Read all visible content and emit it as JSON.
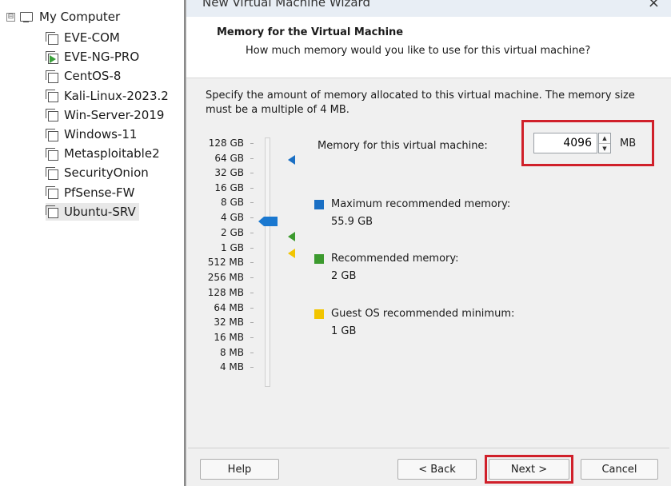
{
  "tree": {
    "root_label": "My Computer",
    "root_expander": "⊟",
    "vms": [
      {
        "label": "EVE-COM",
        "running": false
      },
      {
        "label": "EVE-NG-PRO",
        "running": true
      },
      {
        "label": "CentOS-8",
        "running": false
      },
      {
        "label": "Kali-Linux-2023.2",
        "running": false
      },
      {
        "label": "Win-Server-2019",
        "running": false
      },
      {
        "label": "Windows-11",
        "running": false
      },
      {
        "label": "Metasploitable2",
        "running": false
      },
      {
        "label": "SecurityOnion",
        "running": false
      },
      {
        "label": "PfSense-FW",
        "running": false
      },
      {
        "label": "Ubuntu-SRV",
        "running": false
      }
    ],
    "selected_vm": "Ubuntu-SRV"
  },
  "wizard": {
    "title": "New Virtual Machine Wizard",
    "close_glyph": "×",
    "header_title": "Memory for the Virtual Machine",
    "header_subtitle": "How much memory would you like to use for this virtual machine?",
    "description": "Specify the amount of memory allocated to this virtual machine. The memory size must be a multiple of 4 MB.",
    "scale_labels": [
      "128 GB",
      "64 GB",
      "32 GB",
      "16 GB",
      "8 GB",
      "4 GB",
      "2 GB",
      "1 GB",
      "512 MB",
      "256 MB",
      "128 MB",
      "64 MB",
      "32 MB",
      "16 MB",
      "8 MB",
      "4 MB"
    ],
    "memory_label": "Memory for this virtual machine:",
    "memory_value": "4096",
    "spin_up": "▲",
    "spin_down": "▼",
    "memory_unit": "MB",
    "max_recommended_label": "Maximum recommended memory:",
    "max_recommended_value": "55.9 GB",
    "recommended_label": "Recommended memory:",
    "recommended_value": "2 GB",
    "guest_min_label": "Guest OS recommended minimum:",
    "guest_min_value": "1 GB",
    "buttons": {
      "help": "Help",
      "back": "< Back",
      "next": "Next >",
      "cancel": "Cancel"
    }
  },
  "colors": {
    "max_marker": "#1a6fc4",
    "recommended_marker": "#3c9a2e",
    "guest_min_marker": "#f2c500",
    "slider_thumb": "#1a78d0",
    "highlight_box": "#d0202a"
  }
}
